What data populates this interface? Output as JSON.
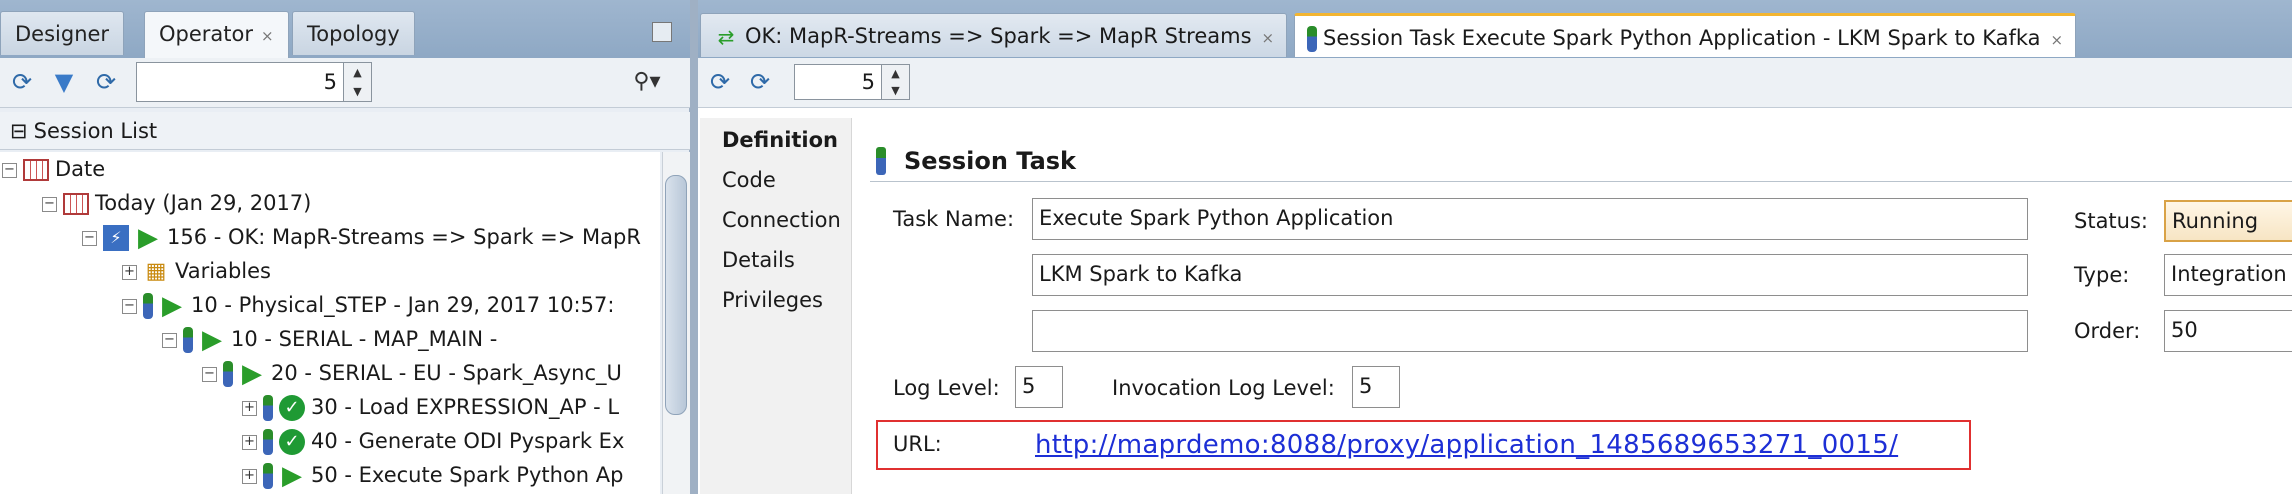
{
  "left_panel": {
    "tabs": [
      {
        "label": "Designer"
      },
      {
        "label": "Operator",
        "close": "×"
      },
      {
        "label": "Topology"
      }
    ],
    "toolbar": {
      "count_value": "5"
    },
    "session_list_header": "Session List",
    "tree": [
      {
        "label": "Date"
      },
      {
        "label": "Today (Jan 29, 2017)"
      },
      {
        "label": "156 - OK: MapR-Streams => Spark => MapR"
      },
      {
        "label": "Variables"
      },
      {
        "label": "10 - Physical_STEP - Jan 29, 2017 10:57:"
      },
      {
        "label": "10 - SERIAL - MAP_MAIN -"
      },
      {
        "label": "20 - SERIAL - EU - Spark_Async_U"
      },
      {
        "label": "30 - Load EXPRESSION_AP - L"
      },
      {
        "label": "40 - Generate ODI Pyspark Ex"
      },
      {
        "label": "50 - Execute Spark Python Ap"
      }
    ]
  },
  "right_panel": {
    "tabs": [
      {
        "label": "OK: MapR-Streams => Spark => MapR Streams",
        "close": "×"
      },
      {
        "label": "Session Task Execute Spark Python Application - LKM Spark to Kafka",
        "close": "×"
      }
    ],
    "toolbar": {
      "count_value": "5"
    },
    "nav": [
      {
        "label": "Definition"
      },
      {
        "label": "Code"
      },
      {
        "label": "Connection"
      },
      {
        "label": "Details"
      },
      {
        "label": "Privileges"
      }
    ],
    "section_title": "Session Task",
    "form": {
      "task_name_label": "Task Name:",
      "task_name": "Execute Spark Python Application",
      "task_line2": "LKM Spark to Kafka",
      "task_line3": "",
      "status_label": "Status:",
      "status": "Running",
      "type_label": "Type:",
      "type": "Integration",
      "order_label": "Order:",
      "order": "50",
      "log_level_label": "Log Level:",
      "log_level": "5",
      "invocation_log_level_label": "Invocation Log Level:",
      "invocation_log_level": "5",
      "url_label": "URL:",
      "url": "http://maprdemo:8088/proxy/application_1485689653271_0015/"
    }
  },
  "colors": {
    "accent_tab": "#f3b531",
    "url_highlight": "#e03030",
    "link": "#1d2fd6"
  }
}
